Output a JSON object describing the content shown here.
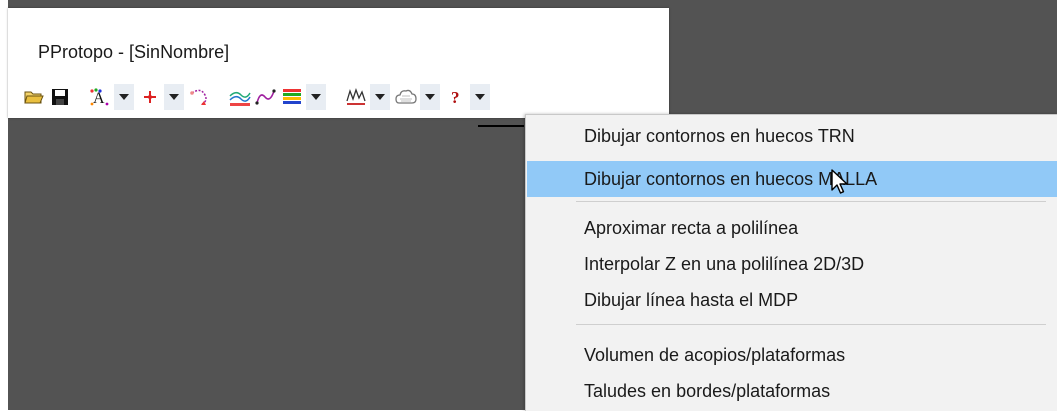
{
  "window": {
    "title": "PProtopo - [SinNombre]"
  },
  "toolbar": {
    "icons": [
      {
        "name": "open-folder-icon",
        "glyph": "📂"
      },
      {
        "name": "save-disk-icon",
        "glyph": "💾"
      },
      {
        "name": "text-style-icon",
        "glyph": "A"
      },
      {
        "name": "point-icon",
        "glyph": "✦"
      },
      {
        "name": "curve-arrow-icon",
        "glyph": "↷"
      },
      {
        "name": "contour-lines-icon",
        "glyph": "≈"
      },
      {
        "name": "polyline-icon",
        "glyph": "∿"
      },
      {
        "name": "color-grid-icon",
        "glyph": "▦"
      },
      {
        "name": "profile-icon",
        "glyph": "⩩"
      },
      {
        "name": "volume-cloud-icon",
        "glyph": "☁"
      },
      {
        "name": "help-icon",
        "glyph": "?"
      }
    ]
  },
  "menu": {
    "items": [
      {
        "label": "Dibujar contornos en huecos TRN",
        "highlighted": false
      },
      {
        "label": "Dibujar contornos en huecos MALLA",
        "highlighted": true
      },
      {
        "label": "Aproximar recta a polilínea",
        "highlighted": false
      },
      {
        "label": "Interpolar Z en una polilínea 2D/3D",
        "highlighted": false
      },
      {
        "label": "Dibujar línea hasta el MDP",
        "highlighted": false
      },
      {
        "label": "Volumen de acopios/plataformas",
        "highlighted": false
      },
      {
        "label": "Taludes en bordes/plataformas",
        "highlighted": false
      }
    ]
  },
  "colors": {
    "background": "#535353",
    "menu_background": "#f2f2f2",
    "highlight": "#91c9f7",
    "toolbar_dropdown": "#e8edf3"
  }
}
